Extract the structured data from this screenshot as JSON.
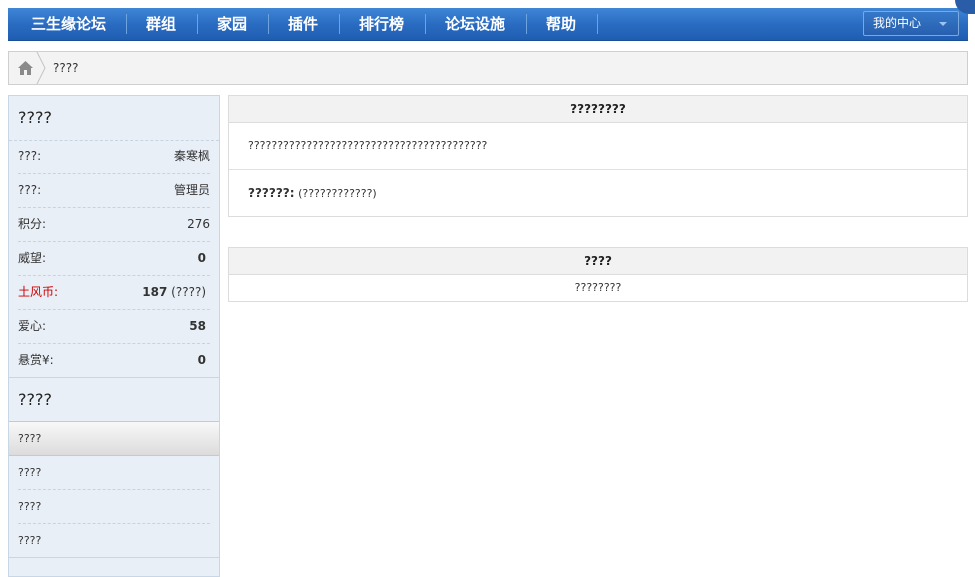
{
  "nav": {
    "items": [
      "三生缘论坛",
      "群组",
      "家园",
      "插件",
      "排行榜",
      "论坛设施",
      "帮助"
    ],
    "my_center": "我的中心"
  },
  "breadcrumb": {
    "current": "????"
  },
  "sidebar": {
    "profile_title": "????",
    "stats": [
      {
        "label": "???:",
        "value": "秦寒枫"
      },
      {
        "label": "???:",
        "value": "管理员"
      },
      {
        "label": "积分:",
        "value": "276"
      },
      {
        "label": "威望:",
        "value": "0"
      },
      {
        "label": "土风币:",
        "value": "187",
        "suffix": "(????)"
      },
      {
        "label": "爱心:",
        "value": "58"
      },
      {
        "label": "悬赏¥:",
        "value": "0"
      }
    ],
    "menu_title": "????",
    "menu_items": [
      "????",
      "????",
      "????",
      "????"
    ]
  },
  "panel1": {
    "header": "????????",
    "message": "?????????????????????????????????????????",
    "row2_label": "??????:",
    "row2_value": "(????????????)"
  },
  "panel2": {
    "header": "????",
    "body": "????????"
  }
}
